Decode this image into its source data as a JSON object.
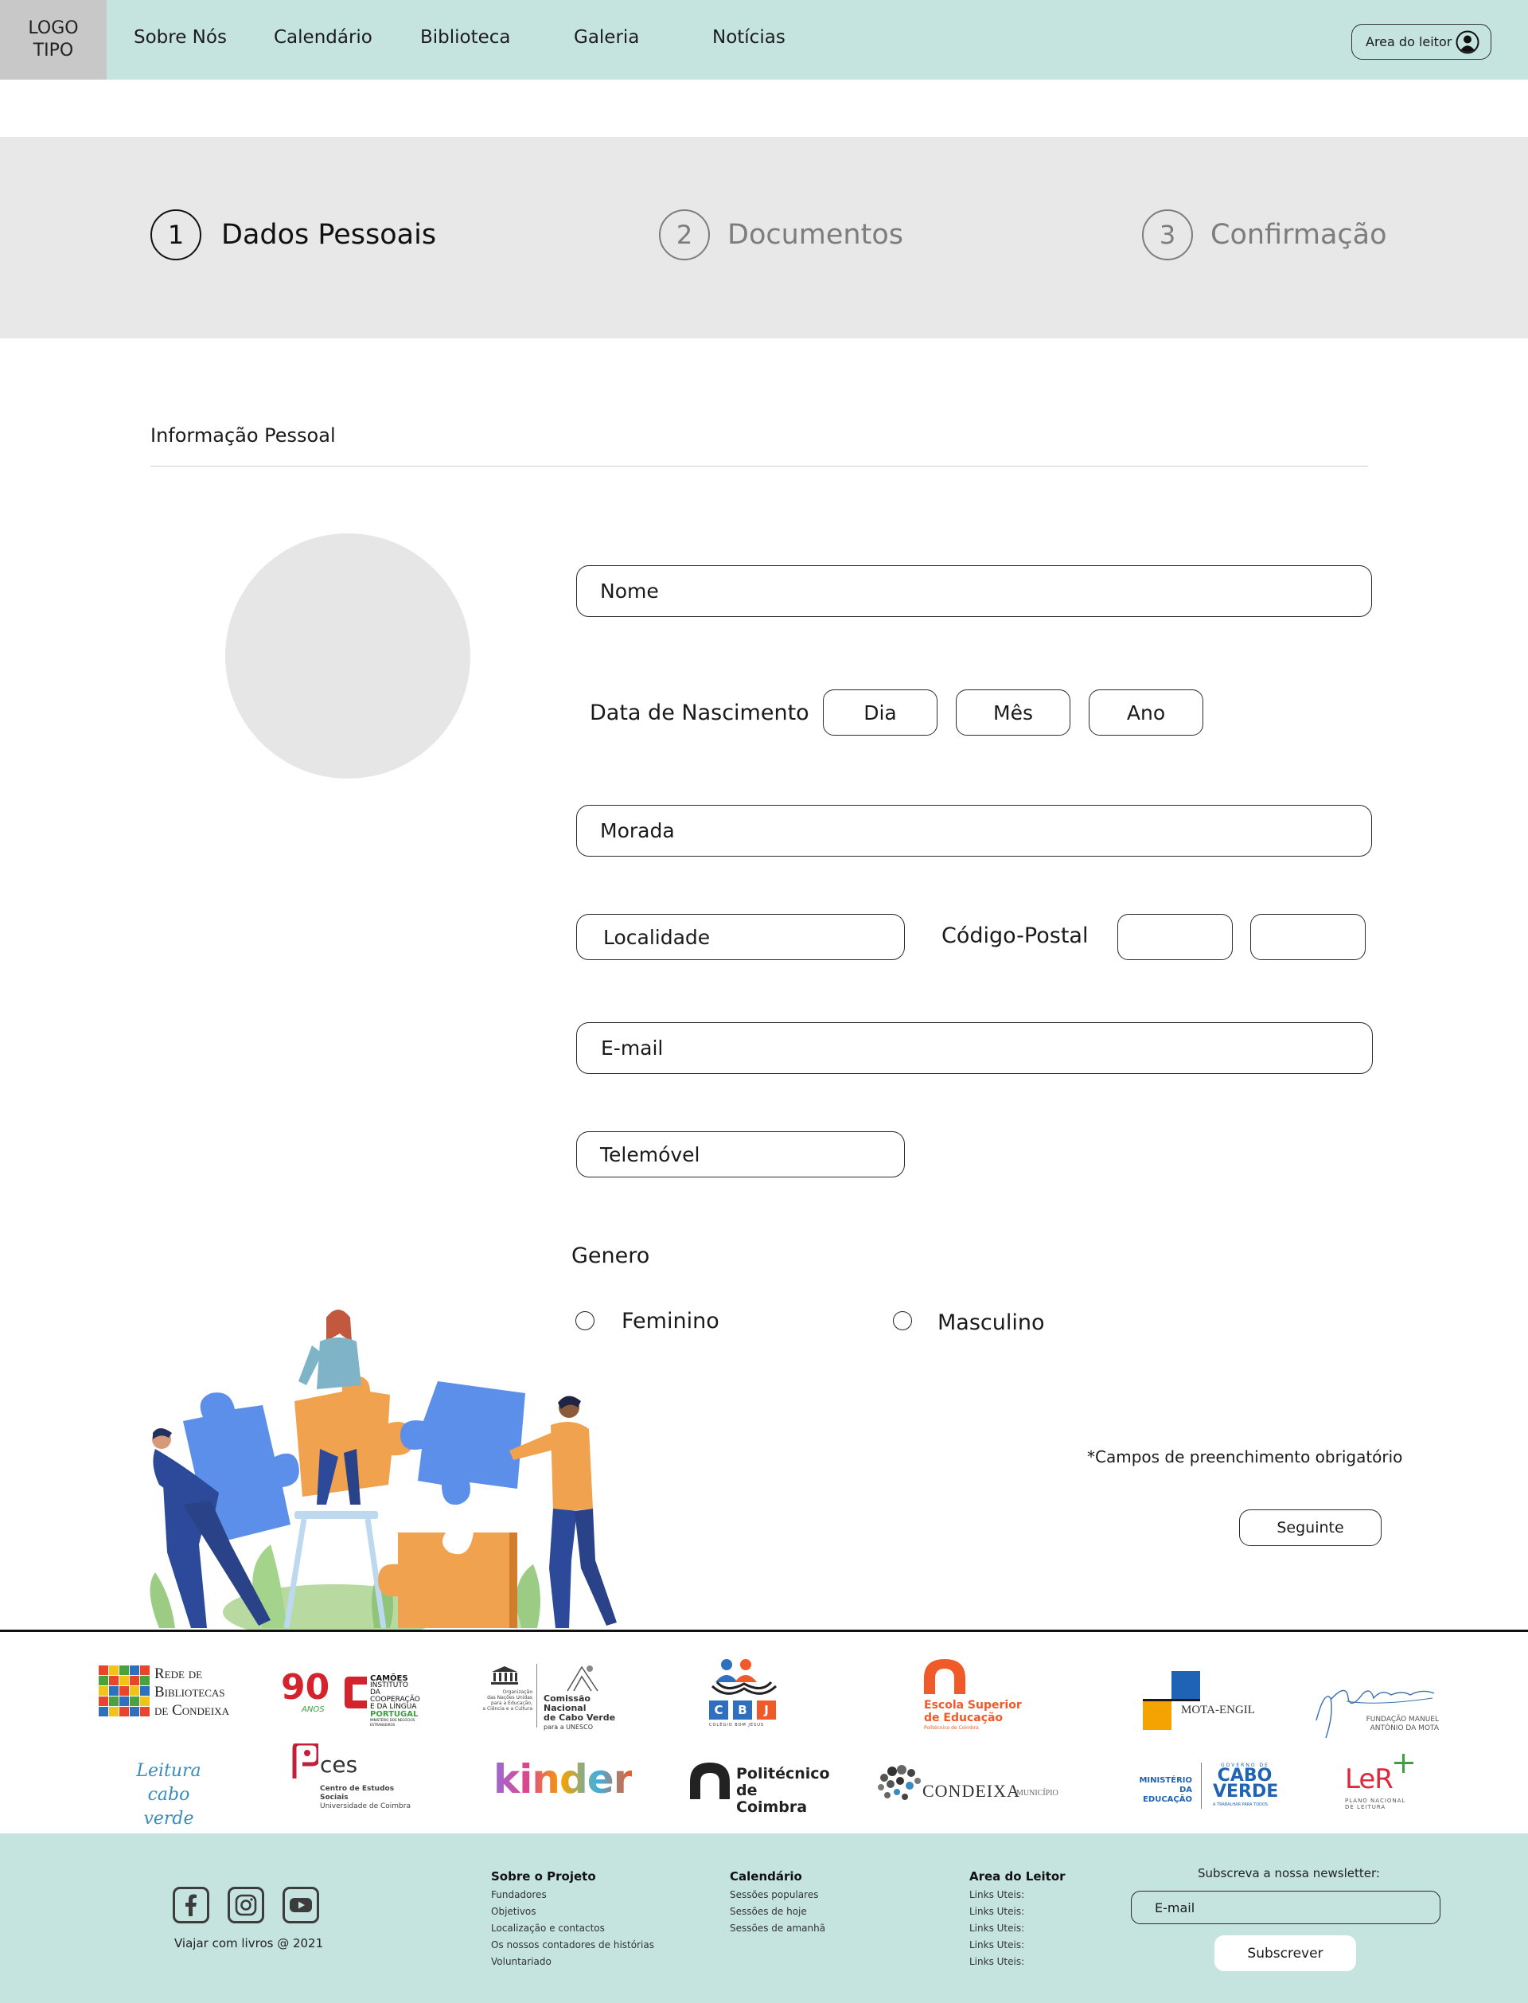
{
  "header": {
    "logo_line1": "LOGO",
    "logo_line2": "TIPO",
    "nav": [
      "Sobre Nós",
      "Calendário",
      "Biblioteca",
      "Galeria",
      "Notícias"
    ],
    "reader_area": "Area do leitor",
    "background_color": "#c5e3df"
  },
  "steps": [
    {
      "number": "1",
      "label": "Dados Pessoais",
      "active": true
    },
    {
      "number": "2",
      "label": "Documentos",
      "active": false
    },
    {
      "number": "3",
      "label": "Confirmação",
      "active": false
    }
  ],
  "form": {
    "section_title": "Informação Pessoal",
    "name_placeholder": "Nome",
    "birth_label": "Data de Nascimento",
    "day": "Dia",
    "month": "Mês",
    "year": "Ano",
    "address_placeholder": "Morada",
    "locality_placeholder": "Localidade",
    "postal_label": "Código-Postal",
    "email_placeholder": "E-mail",
    "phone_placeholder": "Telemóvel",
    "gender_label": "Genero",
    "gender_options": [
      "Feminino",
      "Masculino"
    ],
    "required_note": "*Campos de preenchimento obrigatório",
    "next_button": "Seguinte"
  },
  "partners": {
    "row1": {
      "rede_line1": "Rede de",
      "rede_line2": "Bibliotecas",
      "rede_line3": "de Condeixa",
      "camoes_years": "90",
      "camoes_anos": "ANOS",
      "camoes_name": "CAMÕES",
      "camoes_sub1": "INSTITUTO",
      "camoes_sub2": "DA COOPERAÇÃO",
      "camoes_sub3": "E DA LÍNGUA",
      "camoes_country": "PORTUGAL",
      "camoes_ministry": "MINISTÉRIO DOS NEGÓCIOS ESTRANGEIROS",
      "unesco_org1": "Organização",
      "unesco_org2": "das Nações Unidas",
      "unesco_org3": "para a Educação,",
      "unesco_org4": "a Ciência e a Cultura",
      "unesco_comm1": "Comissão Nacional",
      "unesco_comm2": "de Cabo Verde",
      "unesco_comm3": "para a UNESCO",
      "cbj_letters": [
        "C",
        "B",
        "J"
      ],
      "cbj_sub": "COLÉGIO BOM JESUS",
      "esec_line1": "Escola Superior",
      "esec_line2": "de Educação",
      "esec_sub": "Politécnico de Coimbra",
      "motaengil": "MOTA-ENGIL",
      "fundacao_line1": "FUNDAÇÃO MANUEL",
      "fundacao_line2": "ANTÓNIO DA MOTA"
    },
    "row2": {
      "leitura_line1": "Leitura",
      "leitura_line2": "cabo verde",
      "ces_name": "ces",
      "ces_line1": "Centro de Estudos Sociais",
      "ces_line2": "Universidade de Coimbra",
      "kinder": "kinder",
      "poli_line1": "Politécnico",
      "poli_line2": "de Coimbra",
      "condeixa": "CONDEIXA",
      "condeixa_sub": "MUNICÍPIO",
      "min_line1": "MINISTÉRIO DA",
      "min_line2": "EDUCAÇÃO",
      "cv_gov": "GOVERNO DE",
      "cv_line1": "CABO",
      "cv_line2": "VERDE",
      "cv_slogan": "A TRABALHAR PARA TODOS",
      "ler": "LeR",
      "ler_line1": "PLANO NACIONAL",
      "ler_line2": "DE LEITURA"
    }
  },
  "footer": {
    "copyright": "Viajar com livros @ 2021",
    "columns": [
      {
        "title": "Sobre o Projeto",
        "items": [
          "Fundadores",
          "Objetivos",
          "Localização e contactos",
          "Os nossos contadores de histórias",
          "Voluntariado"
        ]
      },
      {
        "title": "Calendário",
        "items": [
          "Sessões populares",
          "Sessões de hoje",
          "Sessões de amanhã"
        ]
      },
      {
        "title": "Area do Leitor",
        "items": [
          "Links Uteis:",
          "Links Uteis:",
          "Links Uteis:",
          "Links Uteis:",
          "Links Uteis:"
        ]
      }
    ],
    "newsletter_title": "Subscreva a nossa newsletter:",
    "newsletter_placeholder": "E-mail",
    "subscribe_button": "Subscrever",
    "social_icons": [
      "facebook-icon",
      "instagram-icon",
      "youtube-icon"
    ]
  },
  "colors": {
    "accent_teal": "#c5e3df",
    "step_band": "#e8e8e8",
    "puzzle_blue": "#5b8fea",
    "puzzle_orange": "#f0a24e"
  }
}
